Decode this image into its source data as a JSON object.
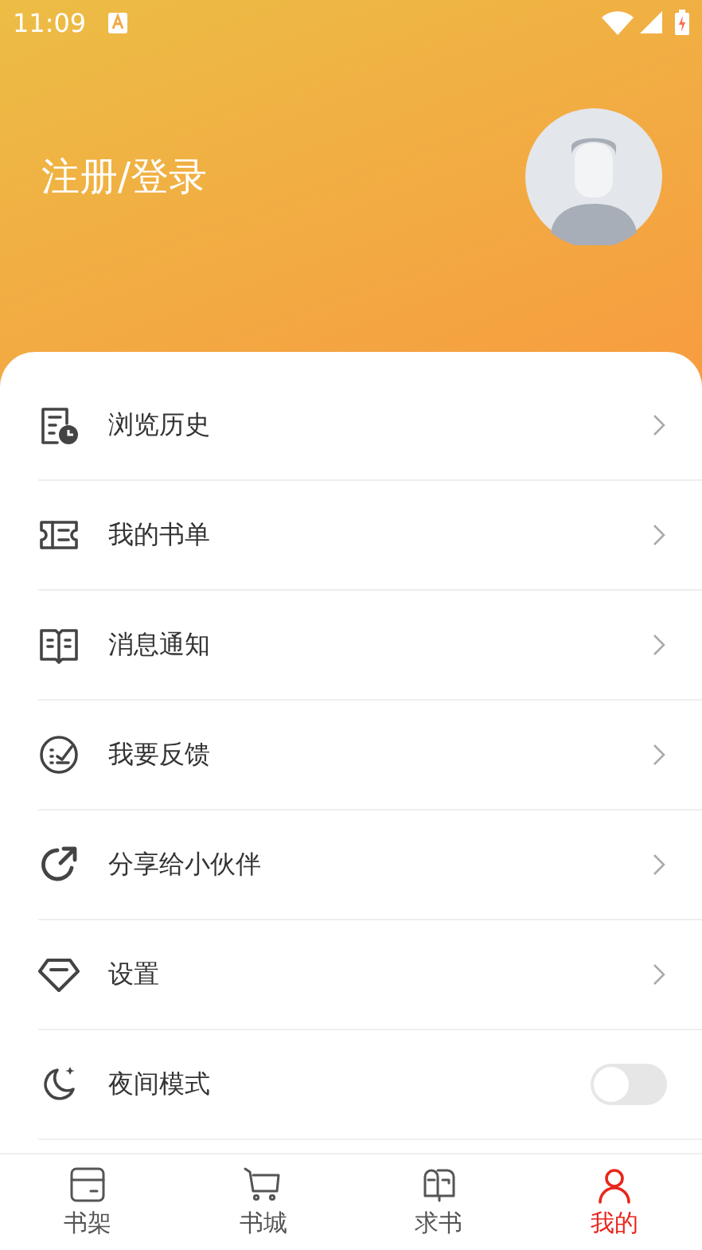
{
  "status_bar": {
    "time": "11:09"
  },
  "profile": {
    "login_label": "注册/登录"
  },
  "menu": [
    {
      "kind": "link",
      "label": "浏览历史"
    },
    {
      "kind": "link",
      "label": "我的书单"
    },
    {
      "kind": "link",
      "label": "消息通知"
    },
    {
      "kind": "link",
      "label": "我要反馈"
    },
    {
      "kind": "link",
      "label": "分享给小伙伴"
    },
    {
      "kind": "link",
      "label": "设置"
    },
    {
      "kind": "toggle",
      "label": "夜间模式",
      "on": false
    }
  ],
  "tabs": [
    {
      "label": "书架",
      "selected": false
    },
    {
      "label": "书城",
      "selected": false
    },
    {
      "label": "求书",
      "selected": false
    },
    {
      "label": "我的",
      "selected": true
    }
  ]
}
